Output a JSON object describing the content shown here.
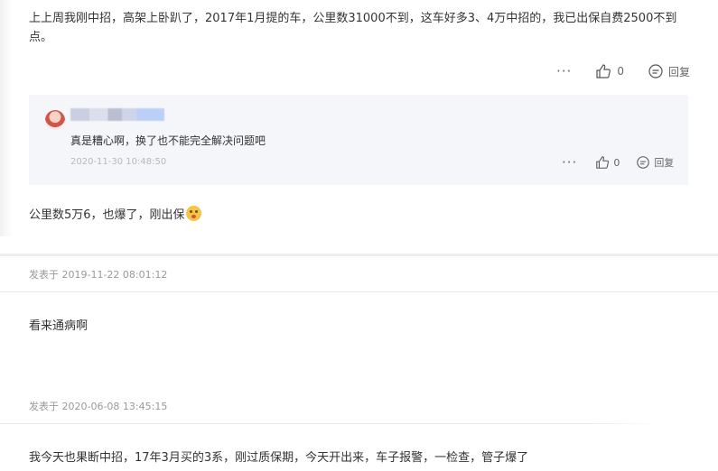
{
  "post": {
    "text": "上上周我刚中招，高架上卧趴了，2017年1月提的车，公里数31000不到，这车好多3、4万中招的，我已出保自费2500不到点。",
    "more": "···",
    "like_count": "0",
    "reply_label": "回复"
  },
  "reply": {
    "text": "真是糟心啊，换了也不能完全解决问题吧",
    "time": "2020-11-30 10:48:50",
    "more": "···",
    "like_count": "0",
    "reply_label": "回复"
  },
  "comments": [
    {
      "text": "公里数5万6，也爆了，刚出保",
      "meta": "发表于 2019-11-22 08:01:12",
      "has_emoji": true
    },
    {
      "text": "看来通病啊",
      "meta": "发表于 2020-06-08 13:45:15"
    },
    {
      "text": "我今天也果断中招，17年3月买的3系，刚过质保期，今天开出来，车子报警，一检查，管子爆了"
    }
  ]
}
